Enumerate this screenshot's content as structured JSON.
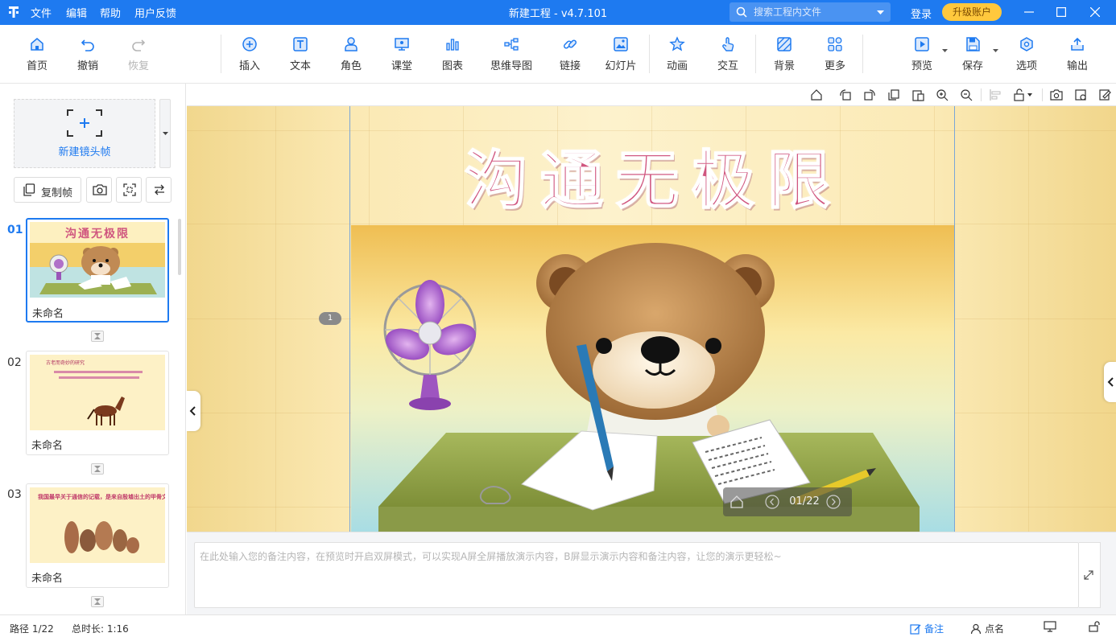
{
  "titlebar": {
    "menu": [
      "文件",
      "编辑",
      "帮助",
      "用户反馈"
    ],
    "title": "新建工程 - v4.7.101",
    "search_placeholder": "搜索工程内文件",
    "login": "登录",
    "upgrade": "升级账户"
  },
  "toolbar": {
    "home": "首页",
    "undo": "撤销",
    "redo": "恢复",
    "insert": "插入",
    "text": "文本",
    "role": "角色",
    "class": "课堂",
    "chart": "图表",
    "mindmap": "思维导图",
    "link": "链接",
    "slide": "幻灯片",
    "animation": "动画",
    "interaction": "交互",
    "background": "背景",
    "more": "更多",
    "preview": "预览",
    "save": "保存",
    "options": "选项",
    "export": "输出"
  },
  "left_panel": {
    "new_frame": "新建镜头帧",
    "copy_frame": "复制帧",
    "frames": [
      {
        "num": "01",
        "name": "未命名",
        "title": "沟通无极限",
        "active": true
      },
      {
        "num": "02",
        "name": "未命名",
        "title": "古老而奇妙的研究",
        "active": false
      },
      {
        "num": "03",
        "name": "未命名",
        "title": "我国最早关于通信的记载，是来自殷墟出土的甲骨文。",
        "active": false
      }
    ]
  },
  "slide": {
    "title": "沟通无极限",
    "frame_badge": "1",
    "page": "01/22"
  },
  "notes": {
    "placeholder": "在此处输入您的备注内容，在预览时开启双屏模式，可以实现A屏全屏播放演示内容，B屏显示演示内容和备注内容，让您的演示更轻松~"
  },
  "status": {
    "path": "路径 1/22",
    "duration": "总时长: 1:16",
    "notes": "备注",
    "rollcall": "点名"
  },
  "colors": {
    "accent": "#1e7af0",
    "upgrade": "#ffc83d",
    "slide_title": "#d0567f"
  }
}
